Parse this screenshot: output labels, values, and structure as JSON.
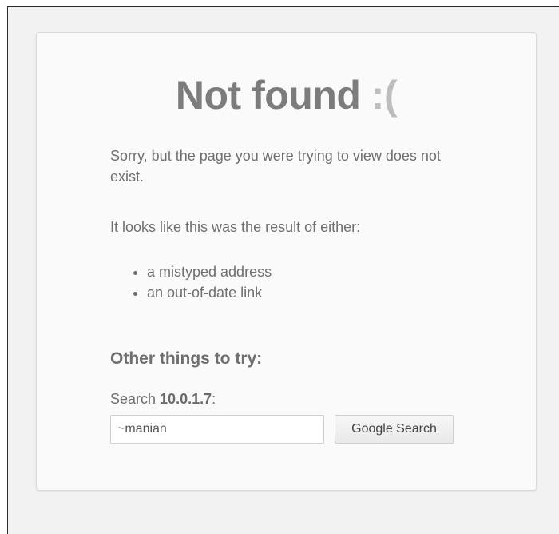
{
  "page": {
    "title_main": "Not found",
    "title_face": " :(",
    "message": "Sorry, but the page you were trying to view does not exist.",
    "reasons_intro": "It looks like this was the result of either:",
    "reasons": [
      "a mistyped address",
      "an out-of-date link"
    ],
    "other_heading": "Other things to try:"
  },
  "search": {
    "label_prefix": "Search ",
    "host": "10.0.1.7",
    "label_suffix": ":",
    "input_value": "~manian",
    "button_label": "Google Search"
  }
}
